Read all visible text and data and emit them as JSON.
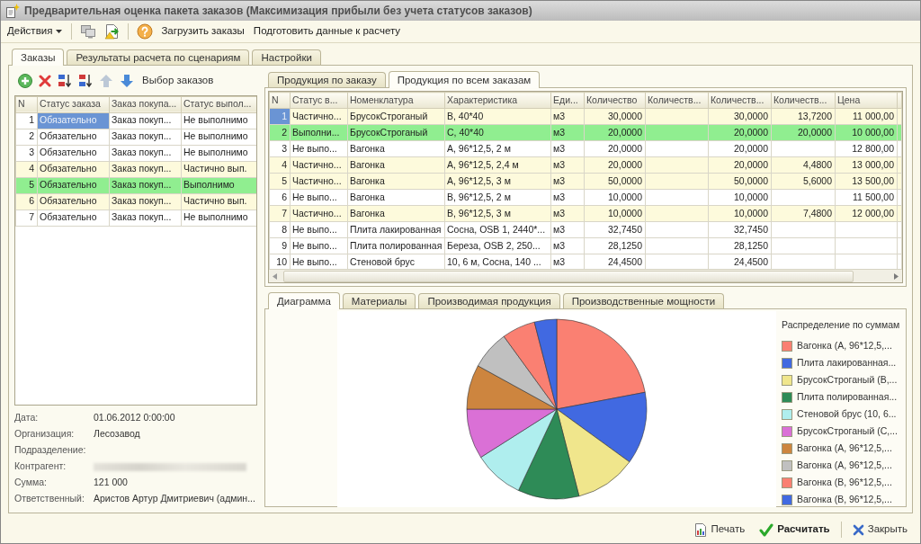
{
  "window": {
    "title": "Предварительная оценка пакета заказов (Максимизация прибыли без учета статусов заказов)"
  },
  "toolbar": {
    "menu": "Действия",
    "buttons": [
      "Загрузить заказы",
      "Подготовить данные к расчету"
    ]
  },
  "tabs": [
    {
      "label": "Заказы",
      "selected": true
    },
    {
      "label": "Результаты расчета по сценариям",
      "selected": false
    },
    {
      "label": "Настройки",
      "selected": false
    }
  ],
  "orders_toolbar": {
    "move_up": {
      "disabled": true
    },
    "move_down": {
      "disabled": false
    },
    "button": "Выбор заказов"
  },
  "orders_table": {
    "columns": [
      "N",
      "Статус заказа",
      "Заказ покупа...",
      "Статус выпол..."
    ],
    "rows": [
      {
        "cells": [
          "1",
          "Обязательно",
          "Заказ покуп...",
          "Не выполнимо"
        ],
        "color": "#ffffff",
        "selected": true
      },
      {
        "cells": [
          "2",
          "Обязательно",
          "Заказ покуп...",
          "Не выполнимо"
        ],
        "color": "#ffffff",
        "selected": false
      },
      {
        "cells": [
          "3",
          "Обязательно",
          "Заказ покуп...",
          "Не выполнимо"
        ],
        "color": "#ffffff",
        "selected": false
      },
      {
        "cells": [
          "4",
          "Обязательно",
          "Заказ покуп...",
          "Частично вып."
        ],
        "color": "#fdfadc",
        "selected": false
      },
      {
        "cells": [
          "5",
          "Обязательно",
          "Заказ покуп...",
          "Выполнимо"
        ],
        "color": "#90ee90",
        "selected": false
      },
      {
        "cells": [
          "6",
          "Обязательно",
          "Заказ покуп...",
          "Частично вып."
        ],
        "color": "#fdfadc",
        "selected": false
      },
      {
        "cells": [
          "7",
          "Обязательно",
          "Заказ покуп...",
          "Не выполнимо"
        ],
        "color": "#ffffff",
        "selected": false
      }
    ]
  },
  "order_details": [
    {
      "label": "Дата:",
      "value": "01.06.2012 0:00:00",
      "redacted": false
    },
    {
      "label": "Организация:",
      "value": "Лесозавод",
      "redacted": false
    },
    {
      "label": "Подразделение:",
      "redacted": false
    },
    {
      "label": "Контрагент:",
      "redacted": true
    },
    {
      "label": "Сумма:",
      "value": "121 000",
      "redacted": false
    },
    {
      "label": "Ответственный:",
      "value": "Аристов Артур Дмитриевич (админ...",
      "redacted": false
    }
  ],
  "product_tabs": [
    {
      "label": "Продукция по заказу",
      "selected": false
    },
    {
      "label": "Продукция по всем заказам",
      "selected": true
    }
  ],
  "products_table": {
    "columns": [
      "N",
      "Статус в...",
      "Номенклатура",
      "Характеристика",
      "Еди...",
      "Количество",
      "Количеств...",
      "Количеств...",
      "Количеств...",
      "Цена"
    ],
    "rows": [
      {
        "cells": [
          "1",
          "Частично...",
          "БрусокСтроганый",
          "В, 40*40",
          "м3",
          "30,0000",
          null,
          "30,0000",
          "13,7200",
          "11 000,00"
        ],
        "color": "#fdfadc",
        "selected": true
      },
      {
        "cells": [
          "2",
          "Выполни...",
          "БрусокСтроганый",
          "С, 40*40",
          "м3",
          "20,0000",
          null,
          "20,0000",
          "20,0000",
          "10 000,00"
        ],
        "color": "#90ee90",
        "selected": false
      },
      {
        "cells": [
          "3",
          "Не выпо...",
          "Вагонка",
          "А, 96*12,5, 2 м",
          "м3",
          "20,0000",
          null,
          "20,0000",
          null,
          "12 800,00"
        ],
        "color": "#ffffff",
        "selected": false
      },
      {
        "cells": [
          "4",
          "Частично...",
          "Вагонка",
          "А, 96*12,5, 2,4 м",
          "м3",
          "20,0000",
          null,
          "20,0000",
          "4,4800",
          "13 000,00"
        ],
        "color": "#fdfadc",
        "selected": false
      },
      {
        "cells": [
          "5",
          "Частично...",
          "Вагонка",
          "А, 96*12,5, 3 м",
          "м3",
          "50,0000",
          null,
          "50,0000",
          "5,6000",
          "13 500,00"
        ],
        "color": "#fdfadc",
        "selected": false
      },
      {
        "cells": [
          "6",
          "Не выпо...",
          "Вагонка",
          "В, 96*12,5, 2 м",
          "м3",
          "10,0000",
          null,
          "10,0000",
          null,
          "11 500,00"
        ],
        "color": "#ffffff",
        "selected": false
      },
      {
        "cells": [
          "7",
          "Частично...",
          "Вагонка",
          "В, 96*12,5, 3 м",
          "м3",
          "10,0000",
          null,
          "10,0000",
          "7,4800",
          "12 000,00"
        ],
        "color": "#fdfadc",
        "selected": false
      },
      {
        "cells": [
          "8",
          "Не выпо...",
          "Плита лакированная",
          "Сосна, OSB 1, 2440*...",
          "м3",
          "32,7450",
          null,
          "32,7450",
          null,
          null
        ],
        "color": "#ffffff",
        "selected": false
      },
      {
        "cells": [
          "9",
          "Не выпо...",
          "Плита полированная",
          "Береза, OSB 2, 250...",
          "м3",
          "28,1250",
          null,
          "28,1250",
          null,
          null
        ],
        "color": "#ffffff",
        "selected": false
      },
      {
        "cells": [
          "10",
          "Не выпо...",
          "Стеновой брус",
          "10, 6 м, Сосна, 140 ...",
          "м3",
          "24,4500",
          null,
          "24,4500",
          null,
          null
        ],
        "color": "#ffffff",
        "selected": false
      }
    ]
  },
  "chart_tabs": [
    {
      "label": "Диаграмма",
      "selected": true
    },
    {
      "label": "Материалы",
      "selected": false
    },
    {
      "label": "Производимая продукция",
      "selected": false
    },
    {
      "label": "Производственные мощности",
      "selected": false
    }
  ],
  "chart": {
    "chart_data": {
      "type": "pie",
      "title": "Распределение по суммам",
      "categories": [
        "Вагонка (А, 96*12,5,...",
        "Плита лакированная...",
        "БрусокСтроганый (В,...",
        "Плита полированная...",
        "Стеновой брус (10, 6...",
        "БрусокСтроганый (С,...",
        "Вагонка (А, 96*12,5,...",
        "Вагонка (А, 96*12,5,...",
        "Вагонка (В, 96*12,5,...",
        "Вагонка (В, 96*12,5,..."
      ],
      "values": [
        22,
        13,
        11,
        11,
        9,
        9,
        8,
        7,
        6,
        4
      ],
      "colors": [
        "#fa8072",
        "#4169e1",
        "#f0e68c",
        "#2e8b57",
        "#afeeee",
        "#da70d6",
        "#cd853f",
        "#c0c0c0",
        "#fa8072",
        "#4169e1"
      ],
      "legend": "right"
    }
  },
  "footer_buttons": [
    {
      "kind": "print",
      "label": "Печать",
      "default": false
    },
    {
      "kind": "calculate",
      "label": "Расчитать",
      "default": true
    },
    {
      "kind": "close",
      "label": "Закрыть",
      "default": false
    }
  ]
}
